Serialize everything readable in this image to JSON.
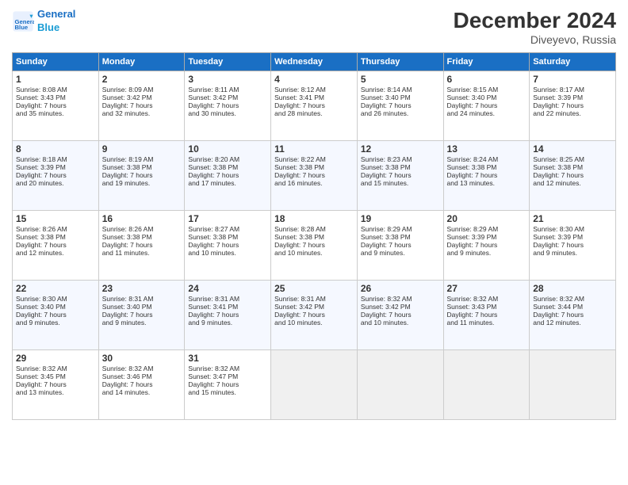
{
  "header": {
    "logo_line1": "General",
    "logo_line2": "Blue",
    "month": "December 2024",
    "location": "Diveyevo, Russia"
  },
  "days_of_week": [
    "Sunday",
    "Monday",
    "Tuesday",
    "Wednesday",
    "Thursday",
    "Friday",
    "Saturday"
  ],
  "weeks": [
    [
      {
        "day": 1,
        "lines": [
          "Sunrise: 8:08 AM",
          "Sunset: 3:43 PM",
          "Daylight: 7 hours",
          "and 35 minutes."
        ]
      },
      {
        "day": 2,
        "lines": [
          "Sunrise: 8:09 AM",
          "Sunset: 3:42 PM",
          "Daylight: 7 hours",
          "and 32 minutes."
        ]
      },
      {
        "day": 3,
        "lines": [
          "Sunrise: 8:11 AM",
          "Sunset: 3:42 PM",
          "Daylight: 7 hours",
          "and 30 minutes."
        ]
      },
      {
        "day": 4,
        "lines": [
          "Sunrise: 8:12 AM",
          "Sunset: 3:41 PM",
          "Daylight: 7 hours",
          "and 28 minutes."
        ]
      },
      {
        "day": 5,
        "lines": [
          "Sunrise: 8:14 AM",
          "Sunset: 3:40 PM",
          "Daylight: 7 hours",
          "and 26 minutes."
        ]
      },
      {
        "day": 6,
        "lines": [
          "Sunrise: 8:15 AM",
          "Sunset: 3:40 PM",
          "Daylight: 7 hours",
          "and 24 minutes."
        ]
      },
      {
        "day": 7,
        "lines": [
          "Sunrise: 8:17 AM",
          "Sunset: 3:39 PM",
          "Daylight: 7 hours",
          "and 22 minutes."
        ]
      }
    ],
    [
      {
        "day": 8,
        "lines": [
          "Sunrise: 8:18 AM",
          "Sunset: 3:39 PM",
          "Daylight: 7 hours",
          "and 20 minutes."
        ]
      },
      {
        "day": 9,
        "lines": [
          "Sunrise: 8:19 AM",
          "Sunset: 3:38 PM",
          "Daylight: 7 hours",
          "and 19 minutes."
        ]
      },
      {
        "day": 10,
        "lines": [
          "Sunrise: 8:20 AM",
          "Sunset: 3:38 PM",
          "Daylight: 7 hours",
          "and 17 minutes."
        ]
      },
      {
        "day": 11,
        "lines": [
          "Sunrise: 8:22 AM",
          "Sunset: 3:38 PM",
          "Daylight: 7 hours",
          "and 16 minutes."
        ]
      },
      {
        "day": 12,
        "lines": [
          "Sunrise: 8:23 AM",
          "Sunset: 3:38 PM",
          "Daylight: 7 hours",
          "and 15 minutes."
        ]
      },
      {
        "day": 13,
        "lines": [
          "Sunrise: 8:24 AM",
          "Sunset: 3:38 PM",
          "Daylight: 7 hours",
          "and 13 minutes."
        ]
      },
      {
        "day": 14,
        "lines": [
          "Sunrise: 8:25 AM",
          "Sunset: 3:38 PM",
          "Daylight: 7 hours",
          "and 12 minutes."
        ]
      }
    ],
    [
      {
        "day": 15,
        "lines": [
          "Sunrise: 8:26 AM",
          "Sunset: 3:38 PM",
          "Daylight: 7 hours",
          "and 12 minutes."
        ]
      },
      {
        "day": 16,
        "lines": [
          "Sunrise: 8:26 AM",
          "Sunset: 3:38 PM",
          "Daylight: 7 hours",
          "and 11 minutes."
        ]
      },
      {
        "day": 17,
        "lines": [
          "Sunrise: 8:27 AM",
          "Sunset: 3:38 PM",
          "Daylight: 7 hours",
          "and 10 minutes."
        ]
      },
      {
        "day": 18,
        "lines": [
          "Sunrise: 8:28 AM",
          "Sunset: 3:38 PM",
          "Daylight: 7 hours",
          "and 10 minutes."
        ]
      },
      {
        "day": 19,
        "lines": [
          "Sunrise: 8:29 AM",
          "Sunset: 3:38 PM",
          "Daylight: 7 hours",
          "and 9 minutes."
        ]
      },
      {
        "day": 20,
        "lines": [
          "Sunrise: 8:29 AM",
          "Sunset: 3:39 PM",
          "Daylight: 7 hours",
          "and 9 minutes."
        ]
      },
      {
        "day": 21,
        "lines": [
          "Sunrise: 8:30 AM",
          "Sunset: 3:39 PM",
          "Daylight: 7 hours",
          "and 9 minutes."
        ]
      }
    ],
    [
      {
        "day": 22,
        "lines": [
          "Sunrise: 8:30 AM",
          "Sunset: 3:40 PM",
          "Daylight: 7 hours",
          "and 9 minutes."
        ]
      },
      {
        "day": 23,
        "lines": [
          "Sunrise: 8:31 AM",
          "Sunset: 3:40 PM",
          "Daylight: 7 hours",
          "and 9 minutes."
        ]
      },
      {
        "day": 24,
        "lines": [
          "Sunrise: 8:31 AM",
          "Sunset: 3:41 PM",
          "Daylight: 7 hours",
          "and 9 minutes."
        ]
      },
      {
        "day": 25,
        "lines": [
          "Sunrise: 8:31 AM",
          "Sunset: 3:42 PM",
          "Daylight: 7 hours",
          "and 10 minutes."
        ]
      },
      {
        "day": 26,
        "lines": [
          "Sunrise: 8:32 AM",
          "Sunset: 3:42 PM",
          "Daylight: 7 hours",
          "and 10 minutes."
        ]
      },
      {
        "day": 27,
        "lines": [
          "Sunrise: 8:32 AM",
          "Sunset: 3:43 PM",
          "Daylight: 7 hours",
          "and 11 minutes."
        ]
      },
      {
        "day": 28,
        "lines": [
          "Sunrise: 8:32 AM",
          "Sunset: 3:44 PM",
          "Daylight: 7 hours",
          "and 12 minutes."
        ]
      }
    ],
    [
      {
        "day": 29,
        "lines": [
          "Sunrise: 8:32 AM",
          "Sunset: 3:45 PM",
          "Daylight: 7 hours",
          "and 13 minutes."
        ]
      },
      {
        "day": 30,
        "lines": [
          "Sunrise: 8:32 AM",
          "Sunset: 3:46 PM",
          "Daylight: 7 hours",
          "and 14 minutes."
        ]
      },
      {
        "day": 31,
        "lines": [
          "Sunrise: 8:32 AM",
          "Sunset: 3:47 PM",
          "Daylight: 7 hours",
          "and 15 minutes."
        ]
      },
      null,
      null,
      null,
      null
    ]
  ],
  "colors": {
    "header_bg": "#1a6fc4",
    "header_text": "#ffffff",
    "accent": "#1a6fc4"
  }
}
